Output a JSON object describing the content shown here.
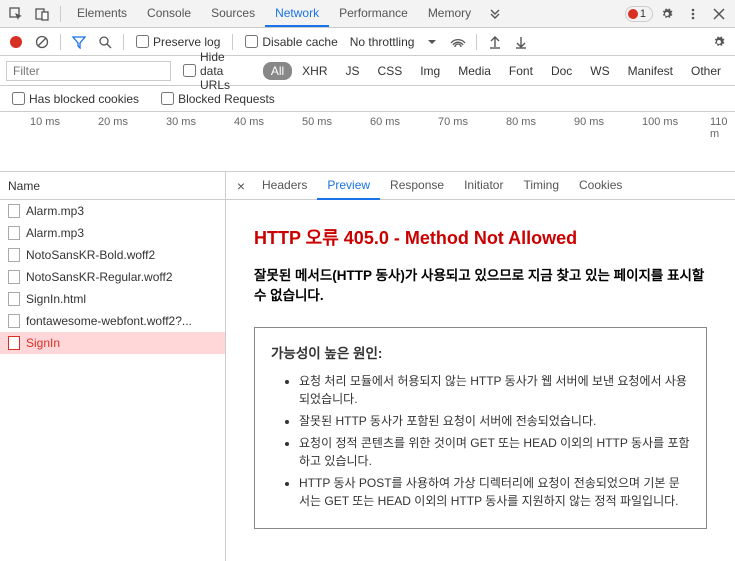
{
  "header": {
    "tabs": [
      "Elements",
      "Console",
      "Sources",
      "Network",
      "Performance",
      "Memory"
    ],
    "activeTab": 3,
    "errorCount": "1"
  },
  "toolbar": {
    "preserveLog": "Preserve log",
    "disableCache": "Disable cache",
    "throttling": "No throttling"
  },
  "filter": {
    "placeholder": "Filter",
    "hideData": "Hide data URLs",
    "types": [
      "All",
      "XHR",
      "JS",
      "CSS",
      "Img",
      "Media",
      "Font",
      "Doc",
      "WS",
      "Manifest",
      "Other"
    ],
    "activeType": 0
  },
  "cookies": {
    "blockedCookies": "Has blocked cookies",
    "blockedRequests": "Blocked Requests"
  },
  "timeline": {
    "ticks": [
      "10 ms",
      "20 ms",
      "30 ms",
      "40 ms",
      "50 ms",
      "60 ms",
      "70 ms",
      "80 ms",
      "90 ms",
      "100 ms",
      "110 m"
    ]
  },
  "requests": {
    "header": "Name",
    "items": [
      {
        "name": "Alarm.mp3",
        "selected": false
      },
      {
        "name": "Alarm.mp3",
        "selected": false
      },
      {
        "name": "NotoSansKR-Bold.woff2",
        "selected": false
      },
      {
        "name": "NotoSansKR-Regular.woff2",
        "selected": false
      },
      {
        "name": "SignIn.html",
        "selected": false
      },
      {
        "name": "fontawesome-webfont.woff2?...",
        "selected": false
      },
      {
        "name": "SignIn",
        "selected": true
      }
    ]
  },
  "detail": {
    "tabs": [
      "Headers",
      "Preview",
      "Response",
      "Initiator",
      "Timing",
      "Cookies"
    ],
    "activeTab": 1
  },
  "preview": {
    "title": "HTTP 오류 405.0 - Method Not Allowed",
    "desc": "잘못된 메서드(HTTP 동사)가 사용되고 있으므로 지금 찾고 있는 페이지를 표시할 수 없습니다.",
    "causeTitle": "가능성이 높은 원인:",
    "causes": [
      "요청 처리 모듈에서 허용되지 않는 HTTP 동사가 웹 서버에 보낸 요청에서 사용되었습니다.",
      "잘못된 HTTP 동사가 포함된 요청이 서버에 전송되었습니다.",
      "요청이 정적 콘텐츠를 위한 것이며 GET 또는 HEAD 이외의 HTTP 동사를 포함하고 있습니다.",
      "HTTP 동사 POST를 사용하여 가상 디렉터리에 요청이 전송되었으며 기본 문서는 GET 또는 HEAD 이외의 HTTP 동사를 지원하지 않는 정적 파일입니다."
    ]
  }
}
